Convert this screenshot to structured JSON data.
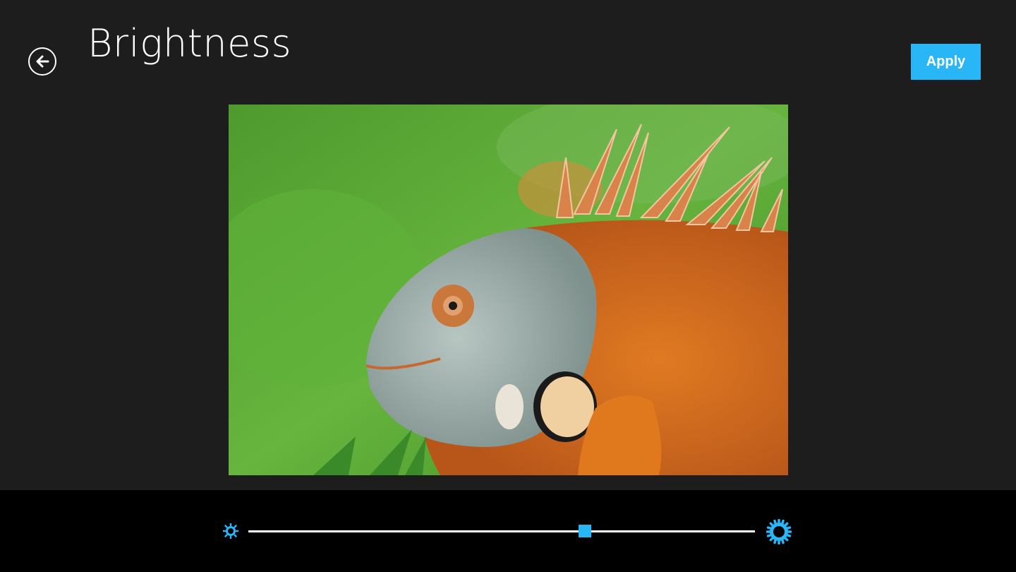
{
  "header": {
    "title": "Brightness",
    "apply_label": "Apply"
  },
  "icons": {
    "back": "back-arrow-icon",
    "min": "sun-small-icon",
    "max": "sun-large-icon"
  },
  "image": {
    "subject": "iguana photo"
  },
  "slider": {
    "value_fraction": 0.665
  },
  "colors": {
    "accent": "#29b6f6",
    "background": "#1d1d1d",
    "bottom_bar": "#000000"
  }
}
